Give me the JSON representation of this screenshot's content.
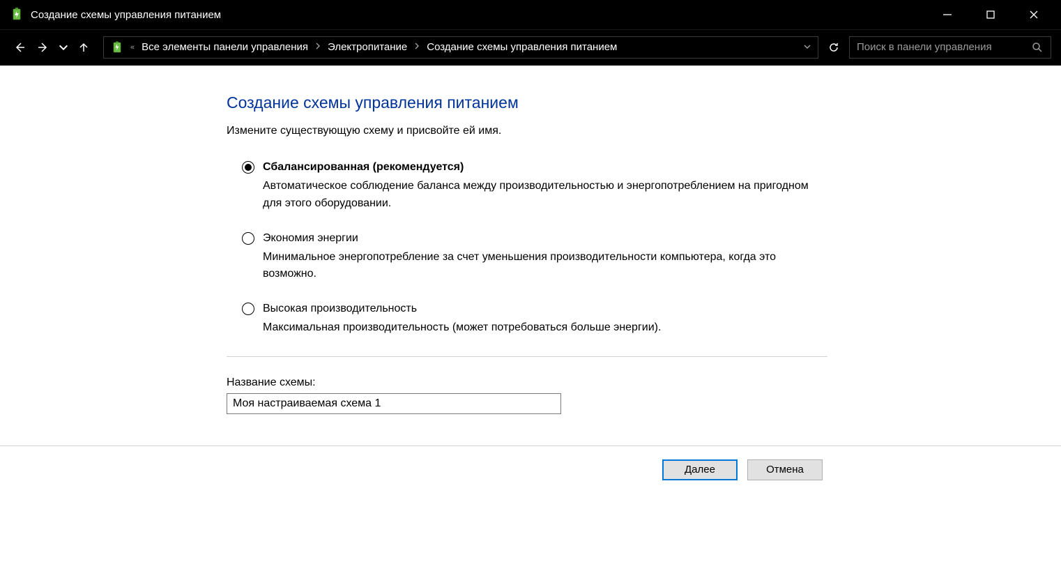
{
  "window": {
    "title": "Создание схемы управления питанием"
  },
  "breadcrumbs": {
    "item0": "Все элементы панели управления",
    "item1": "Электропитание",
    "item2": "Создание схемы управления питанием"
  },
  "search": {
    "placeholder": "Поиск в панели управления"
  },
  "main": {
    "heading": "Создание схемы управления питанием",
    "subtext": "Измените существующую схему и присвойте ей имя.",
    "plans": [
      {
        "title": "Сбалансированная (рекомендуется)",
        "desc": "Автоматическое соблюдение баланса между производительностью и энергопотреблением на пригодном для этого оборудовании.",
        "selected": true
      },
      {
        "title": "Экономия энергии",
        "desc": "Минимальное энергопотребление за счет уменьшения производительности компьютера, когда это возможно.",
        "selected": false
      },
      {
        "title": "Высокая производительность",
        "desc": "Максимальная производительность (может потребоваться больше энергии).",
        "selected": false
      }
    ],
    "plan_name_label": "Название схемы:",
    "plan_name_value": "Моя настраиваемая схема 1"
  },
  "footer": {
    "next": "Далее",
    "cancel": "Отмена"
  }
}
